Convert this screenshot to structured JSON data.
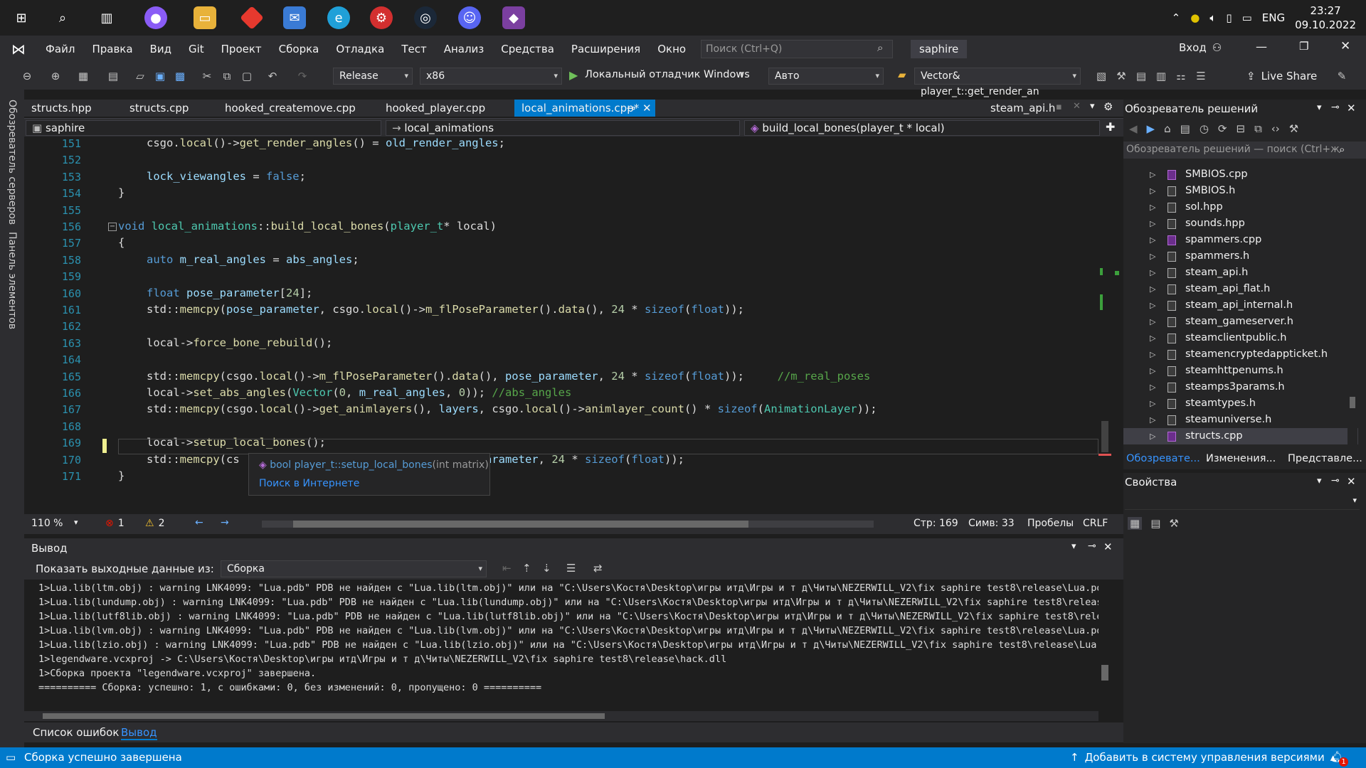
{
  "taskbar": {
    "time": "23:27",
    "date": "09.10.2022",
    "lang": "ENG"
  },
  "menu": [
    "Файл",
    "Правка",
    "Вид",
    "Git",
    "Проект",
    "Сборка",
    "Отладка",
    "Тест",
    "Анализ",
    "Средства",
    "Расширения",
    "Окно",
    "Справка"
  ],
  "search": {
    "placeholder": "Поиск (Ctrl+Q)"
  },
  "solution_name": "saphire",
  "signin": "Вход",
  "toolbar": {
    "config": "Release",
    "platform": "x86",
    "debugger": "Локальный отладчик Windows",
    "auto": "Авто",
    "function": "Vector& player_t::get_render_an",
    "liveshare": "Live Share"
  },
  "leftrail": {
    "servers": "Обозреватель серверов",
    "toolbox": "Панель элементов"
  },
  "tabs": [
    "structs.hpp",
    "structs.cpp",
    "hooked_createmove.cpp",
    "hooked_player.cpp",
    "local_animations.cpp*",
    "steam_api.h"
  ],
  "nav": {
    "project": "saphire",
    "class": "local_animations",
    "member": "build_local_bones(player_t * local)"
  },
  "code": {
    "lines": [
      {
        "n": "151",
        "parts": [
          [
            "",
            "csgo."
          ],
          [
            "fn",
            "local"
          ],
          [
            "",
            "()->"
          ],
          [
            "fn",
            "get_render_angles"
          ],
          [
            "",
            "() = "
          ],
          [
            "vr",
            "old_render_angles"
          ],
          [
            "",
            ";"
          ]
        ]
      },
      {
        "n": "152",
        "parts": []
      },
      {
        "n": "153",
        "parts": [
          [
            "vr",
            "lock_viewangles"
          ],
          [
            "",
            " = "
          ],
          [
            "kw",
            "false"
          ],
          [
            "",
            ";"
          ]
        ]
      },
      {
        "n": "154",
        "parts": [
          [
            "",
            "}"
          ]
        ]
      },
      {
        "n": "155",
        "parts": []
      },
      {
        "n": "156",
        "parts": [
          [
            "kw",
            "void"
          ],
          [
            "",
            " "
          ],
          [
            "ty",
            "local_animations"
          ],
          [
            "",
            "::"
          ],
          [
            "fn",
            "build_local_bones"
          ],
          [
            "",
            "("
          ],
          [
            "ty",
            "player_t"
          ],
          [
            "",
            "* local)"
          ]
        ]
      },
      {
        "n": "157",
        "parts": [
          [
            "",
            "{"
          ]
        ]
      },
      {
        "n": "158",
        "parts": [
          [
            "kw",
            "auto"
          ],
          [
            "",
            " "
          ],
          [
            "vr",
            "m_real_angles"
          ],
          [
            "",
            " = "
          ],
          [
            "vr",
            "abs_angles"
          ],
          [
            "",
            ";"
          ]
        ]
      },
      {
        "n": "159",
        "parts": []
      },
      {
        "n": "160",
        "parts": [
          [
            "kw",
            "float"
          ],
          [
            "",
            " "
          ],
          [
            "vr",
            "pose_parameter"
          ],
          [
            "",
            "["
          ],
          [
            "num",
            "24"
          ],
          [
            "",
            "];"
          ]
        ]
      },
      {
        "n": "161",
        "parts": [
          [
            "",
            "std::"
          ],
          [
            "fn",
            "memcpy"
          ],
          [
            "",
            "("
          ],
          [
            "vr",
            "pose_parameter"
          ],
          [
            "",
            ", csgo."
          ],
          [
            "fn",
            "local"
          ],
          [
            "",
            "()->"
          ],
          [
            "fn",
            "m_flPoseParameter"
          ],
          [
            "",
            "()."
          ],
          [
            "fn",
            "data"
          ],
          [
            "",
            "(), "
          ],
          [
            "num",
            "24"
          ],
          [
            "",
            " * "
          ],
          [
            "kw",
            "sizeof"
          ],
          [
            "",
            "("
          ],
          [
            "kw",
            "float"
          ],
          [
            "",
            "));"
          ]
        ]
      },
      {
        "n": "162",
        "parts": []
      },
      {
        "n": "163",
        "parts": [
          [
            "",
            "local->"
          ],
          [
            "fn",
            "force_bone_rebuild"
          ],
          [
            "",
            "();"
          ]
        ]
      },
      {
        "n": "164",
        "parts": []
      },
      {
        "n": "165",
        "parts": [
          [
            "",
            "std::"
          ],
          [
            "fn",
            "memcpy"
          ],
          [
            "",
            "(csgo."
          ],
          [
            "fn",
            "local"
          ],
          [
            "",
            "()->"
          ],
          [
            "fn",
            "m_flPoseParameter"
          ],
          [
            "",
            "()."
          ],
          [
            "fn",
            "data"
          ],
          [
            "",
            "(), "
          ],
          [
            "vr",
            "pose_parameter"
          ],
          [
            "",
            ", "
          ],
          [
            "num",
            "24"
          ],
          [
            "",
            " * "
          ],
          [
            "kw",
            "sizeof"
          ],
          [
            "",
            "("
          ],
          [
            "kw",
            "float"
          ],
          [
            "",
            "));     "
          ],
          [
            "cm",
            "//m_real_poses"
          ]
        ]
      },
      {
        "n": "166",
        "parts": [
          [
            "",
            "local->"
          ],
          [
            "fn",
            "set_abs_angles"
          ],
          [
            "",
            "("
          ],
          [
            "ty",
            "Vector"
          ],
          [
            "",
            "("
          ],
          [
            "num",
            "0"
          ],
          [
            "",
            ", "
          ],
          [
            "vr",
            "m_real_angles"
          ],
          [
            "",
            ", "
          ],
          [
            "num",
            "0"
          ],
          [
            "",
            "));"
          ],
          [
            "cm",
            " //abs_angles"
          ]
        ]
      },
      {
        "n": "167",
        "parts": [
          [
            "",
            "std::"
          ],
          [
            "fn",
            "memcpy"
          ],
          [
            "",
            "(csgo."
          ],
          [
            "fn",
            "local"
          ],
          [
            "",
            "()->"
          ],
          [
            "fn",
            "get_animlayers"
          ],
          [
            "",
            "(), "
          ],
          [
            "vr",
            "layers"
          ],
          [
            "",
            ", csgo."
          ],
          [
            "fn",
            "local"
          ],
          [
            "",
            "()->"
          ],
          [
            "fn",
            "animlayer_count"
          ],
          [
            "",
            "() * "
          ],
          [
            "kw",
            "sizeof"
          ],
          [
            "",
            "("
          ],
          [
            "ty",
            "AnimationLayer"
          ],
          [
            "",
            "));"
          ]
        ]
      },
      {
        "n": "168",
        "parts": []
      },
      {
        "n": "169",
        "parts": [
          [
            "",
            "local->"
          ],
          [
            "fn",
            "setup_local_bones"
          ],
          [
            "",
            "();"
          ]
        ]
      },
      {
        "n": "170",
        "parts": [
          [
            "",
            "std::"
          ],
          [
            "fn",
            "memcpy"
          ],
          [
            "",
            "(cs"
          ],
          [
            "",
            "                          "
          ],
          [
            "fn",
            "a"
          ],
          [
            "",
            "(), "
          ],
          [
            "vr",
            "pose_parameter"
          ],
          [
            "",
            ", "
          ],
          [
            "num",
            "24"
          ],
          [
            "",
            " * "
          ],
          [
            "kw",
            "sizeof"
          ],
          [
            "",
            "("
          ],
          [
            "kw",
            "float"
          ],
          [
            "",
            "));"
          ]
        ]
      },
      {
        "n": "171",
        "parts": [
          [
            "",
            "}"
          ]
        ]
      }
    ]
  },
  "tooltip": {
    "signature": "bool player_t::setup_local_bones",
    "params": "(int matrix)",
    "link": "Поиск в Интернете"
  },
  "editor_status": {
    "zoom": "110 %",
    "errors": "1",
    "warnings": "2",
    "line": "Стр: 169",
    "col": "Симв: 33",
    "spaces": "Пробелы",
    "eol": "CRLF"
  },
  "output": {
    "title": "Вывод",
    "show_label": "Показать выходные данные из:",
    "source": "Сборка",
    "lines": [
      "1>Lua.lib(ltm.obj) : warning LNK4099: \"Lua.pdb\" PDB не найден с \"Lua.lib(ltm.obj)\" или на \"C:\\Users\\Костя\\Desktop\\игры итд\\Игры и т д\\Читы\\NEZERWILL_V2\\fix saphire test8\\release\\Lua.pdb\"",
      "1>Lua.lib(lundump.obj) : warning LNK4099: \"Lua.pdb\" PDB не найден с \"Lua.lib(lundump.obj)\" или на \"C:\\Users\\Костя\\Desktop\\игры итд\\Игры и т д\\Читы\\NEZERWILL_V2\\fix saphire test8\\release\\",
      "1>Lua.lib(lutf8lib.obj) : warning LNK4099: \"Lua.pdb\" PDB не найден с \"Lua.lib(lutf8lib.obj)\" или на \"C:\\Users\\Костя\\Desktop\\игры итд\\Игры и т д\\Читы\\NEZERWILL_V2\\fix saphire test8\\releas",
      "1>Lua.lib(lvm.obj) : warning LNK4099: \"Lua.pdb\" PDB не найден с \"Lua.lib(lvm.obj)\" или на \"C:\\Users\\Костя\\Desktop\\игры итд\\Игры и т д\\Читы\\NEZERWILL_V2\\fix saphire test8\\release\\Lua.pdb\"",
      "1>Lua.lib(lzio.obj) : warning LNK4099: \"Lua.pdb\" PDB не найден с \"Lua.lib(lzio.obj)\" или на \"C:\\Users\\Костя\\Desktop\\игры итд\\Игры и т д\\Читы\\NEZERWILL_V2\\fix saphire test8\\release\\Lua.pd",
      "1>legendware.vcxproj -> C:\\Users\\Костя\\Desktop\\игры итд\\Игры и т д\\Читы\\NEZERWILL_V2\\fix saphire test8\\release\\hack.dll",
      "1>Сборка проекта \"legendware.vcxproj\" завершена.",
      "========== Сборка: успешно: 1, с ошибками: 0, без изменений: 0, пропущено: 0 =========="
    ]
  },
  "bottom_tabs": [
    "Список ошибок",
    "Вывод"
  ],
  "solution_explorer": {
    "title": "Обозреватель решений",
    "search": "Обозреватель решений — поиск (Ctrl+ж",
    "files": [
      {
        "name": "SMBIOS.cpp",
        "cpp": true
      },
      {
        "name": "SMBIOS.h",
        "cpp": false
      },
      {
        "name": "sol.hpp",
        "cpp": false
      },
      {
        "name": "sounds.hpp",
        "cpp": false
      },
      {
        "name": "spammers.cpp",
        "cpp": true
      },
      {
        "name": "spammers.h",
        "cpp": false
      },
      {
        "name": "steam_api.h",
        "cpp": false
      },
      {
        "name": "steam_api_flat.h",
        "cpp": false
      },
      {
        "name": "steam_api_internal.h",
        "cpp": false
      },
      {
        "name": "steam_gameserver.h",
        "cpp": false
      },
      {
        "name": "steamclientpublic.h",
        "cpp": false
      },
      {
        "name": "steamencryptedappticket.h",
        "cpp": false
      },
      {
        "name": "steamhttpenums.h",
        "cpp": false
      },
      {
        "name": "steamps3params.h",
        "cpp": false
      },
      {
        "name": "steamtypes.h",
        "cpp": false
      },
      {
        "name": "steamuniverse.h",
        "cpp": false
      },
      {
        "name": "structs.cpp",
        "cpp": true
      }
    ],
    "tabs": [
      "Обозревате...",
      "Изменения...",
      "Представле..."
    ]
  },
  "properties": {
    "title": "Свойства"
  },
  "statusbar": {
    "text": "Сборка успешно завершена",
    "vcs": "Добавить в систему управления версиями",
    "notif": "1"
  },
  "colors": {
    "accent": "#007acc",
    "bg": "#1e1e1e"
  }
}
